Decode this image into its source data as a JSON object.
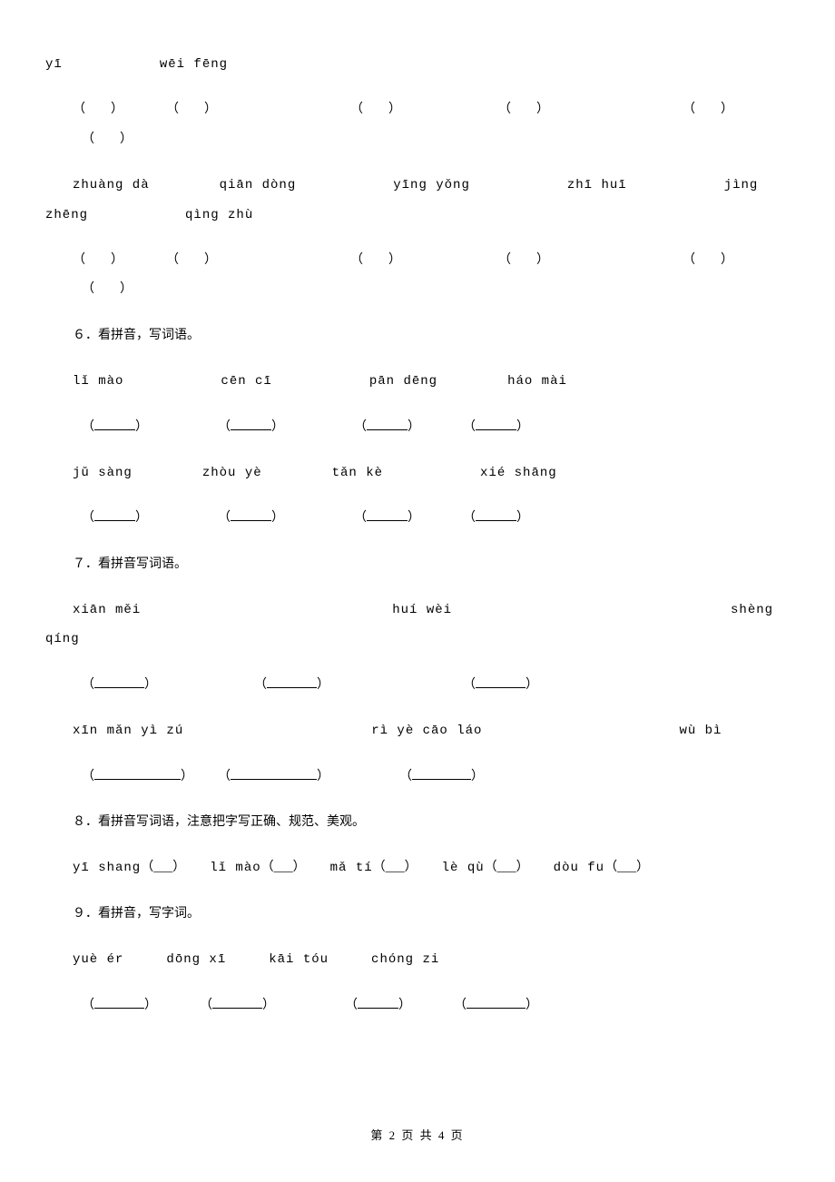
{
  "top_line": {
    "p1": "yī",
    "p2": "wēi fēng"
  },
  "blanks_row1": [
    "（　　）",
    "（　　）",
    "（　　）",
    "（　　）",
    "（　　）",
    "（　　）"
  ],
  "row2": {
    "p1": "zhuàng  dà",
    "p2": "qiān  dòng",
    "p3": "yīng  yǒng",
    "p4": "zhī  huī",
    "p5": "jìng",
    "p6": "zhēng",
    "p7": "qìng zhù"
  },
  "blanks_row2": [
    "（　　）",
    "（　　）",
    "（　　）",
    "（　　）",
    "（　　）",
    "（　　）"
  ],
  "q6": {
    "title": "６．看拼音，写词语。",
    "r1": {
      "p1": "lǐ mào",
      "p2": "cēn cī",
      "p3": "pān dēng",
      "p4": "háo mài"
    },
    "r2": {
      "p1": "jǔ sàng",
      "p2": "zhòu yè",
      "p3": "tǎn kè",
      "p4": "xié shāng"
    }
  },
  "q7": {
    "title": "７．看拼音写词语。",
    "r1": {
      "p1": "xiān  měi",
      "p2": "huí  wèi",
      "p3": "shèng",
      "p4": "qíng"
    },
    "r2": {
      "p1": "xīn mǎn yì zú",
      "p2": "rì yè cāo láo",
      "p3": "wù bì"
    }
  },
  "q8": {
    "title": "８．看拼音写词语，注意把字写正确、规范、美观。",
    "items": [
      {
        "pinyin": "yī shang",
        "blank": "（___）"
      },
      {
        "pinyin": "lǐ mào",
        "blank": "（___）"
      },
      {
        "pinyin": "mǎ tí",
        "blank": "（___）"
      },
      {
        "pinyin": "lè qù",
        "blank": "（___）"
      },
      {
        "pinyin": "dòu fu",
        "blank": "（___）"
      }
    ]
  },
  "q9": {
    "title": "９．看拼音，写字词。",
    "r1": {
      "p1": "yuè   ér",
      "p2": "dōng  xī",
      "p3": "kāi tóu",
      "p4": "chóng  zi"
    }
  },
  "footer": "第 2 页 共 4 页"
}
